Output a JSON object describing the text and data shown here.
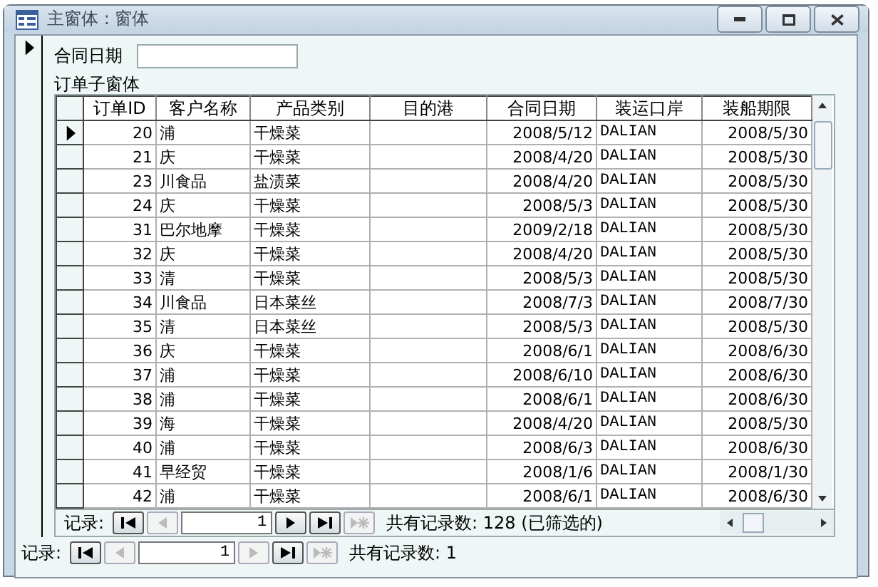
{
  "window": {
    "title": "主窗体 : 窗体"
  },
  "form": {
    "field_label": "合同日期",
    "subform_label": "订单子窗体"
  },
  "table": {
    "columns": [
      "订单ID",
      "客户名称",
      "产品类别",
      "目的港",
      "合同日期",
      "装运口岸",
      "装船期限"
    ],
    "rows": [
      {
        "current": true,
        "cells": [
          "20",
          "浦",
          "干燥菜",
          "",
          "2008/5/12",
          "DALIAN",
          "2008/5/30"
        ]
      },
      {
        "current": false,
        "cells": [
          "21",
          "庆",
          "干燥菜",
          "",
          "2008/4/20",
          "DALIAN",
          "2008/5/30"
        ]
      },
      {
        "current": false,
        "cells": [
          "23",
          "川食品",
          "盐渍菜",
          "",
          "2008/4/20",
          "DALIAN",
          "2008/5/30"
        ]
      },
      {
        "current": false,
        "cells": [
          "24",
          "庆",
          "干燥菜",
          "",
          "2008/5/3",
          "DALIAN",
          "2008/5/30"
        ]
      },
      {
        "current": false,
        "cells": [
          "31",
          "巴尔地摩",
          "干燥菜",
          "",
          "2009/2/18",
          "DALIAN",
          "2008/5/30"
        ]
      },
      {
        "current": false,
        "cells": [
          "32",
          "庆",
          "干燥菜",
          "",
          "2008/4/20",
          "DALIAN",
          "2008/5/30"
        ]
      },
      {
        "current": false,
        "cells": [
          "33",
          "清",
          "干燥菜",
          "",
          "2008/5/3",
          "DALIAN",
          "2008/5/30"
        ]
      },
      {
        "current": false,
        "cells": [
          "34",
          "川食品",
          "日本菜丝",
          "",
          "2008/7/3",
          "DALIAN",
          "2008/7/30"
        ]
      },
      {
        "current": false,
        "cells": [
          "35",
          "清",
          "日本菜丝",
          "",
          "2008/5/3",
          "DALIAN",
          "2008/5/30"
        ]
      },
      {
        "current": false,
        "cells": [
          "36",
          "庆",
          "干燥菜",
          "",
          "2008/6/1",
          "DALIAN",
          "2008/6/30"
        ]
      },
      {
        "current": false,
        "cells": [
          "37",
          "浦",
          "干燥菜",
          "",
          "2008/6/10",
          "DALIAN",
          "2008/6/30"
        ]
      },
      {
        "current": false,
        "cells": [
          "38",
          "浦",
          "干燥菜",
          "",
          "2008/6/1",
          "DALIAN",
          "2008/6/30"
        ]
      },
      {
        "current": false,
        "cells": [
          "39",
          "海",
          "干燥菜",
          "",
          "2008/4/20",
          "DALIAN",
          "2008/5/30"
        ]
      },
      {
        "current": false,
        "cells": [
          "40",
          "浦",
          "干燥菜",
          "",
          "2008/6/3",
          "DALIAN",
          "2008/6/30"
        ]
      },
      {
        "current": false,
        "cells": [
          "41",
          "早经贸",
          "干燥菜",
          "",
          "2008/1/6",
          "DALIAN",
          "2008/1/30"
        ]
      },
      {
        "current": false,
        "cells": [
          "42",
          "浦",
          "干燥菜",
          "",
          "2008/6/1",
          "DALIAN",
          "2008/6/30"
        ]
      }
    ]
  },
  "subform_nav": {
    "label": "记录:",
    "record": "1",
    "buttons": [
      {
        "kind": "first",
        "disabled": false
      },
      {
        "kind": "prev",
        "disabled": true
      },
      {
        "kind": "next",
        "disabled": false
      },
      {
        "kind": "last",
        "disabled": false
      },
      {
        "kind": "new",
        "disabled": true
      }
    ],
    "count": "共有记录数: 128 (已筛选的)"
  },
  "form_nav": {
    "label": "记录:",
    "record": "1",
    "buttons": [
      {
        "kind": "first",
        "disabled": false
      },
      {
        "kind": "prev",
        "disabled": true
      },
      {
        "kind": "next",
        "disabled": true
      },
      {
        "kind": "last",
        "disabled": false
      },
      {
        "kind": "new",
        "disabled": true
      }
    ],
    "count": "共有记录数: 1"
  }
}
